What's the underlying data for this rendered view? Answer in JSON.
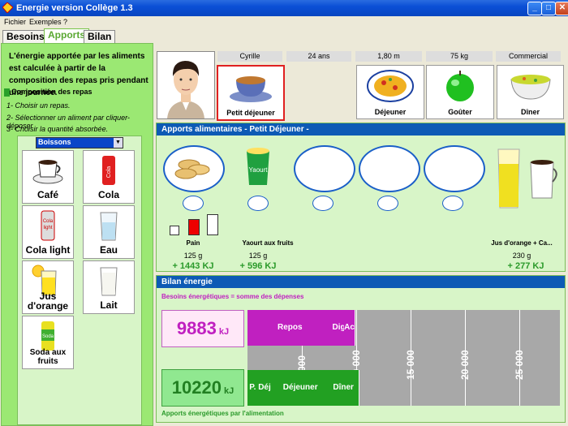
{
  "window": {
    "title": "Energie version Collège 1.3"
  },
  "menu": [
    "Fichier",
    "Exemples",
    "?"
  ],
  "tabs": [
    "Besoins",
    "Apports",
    "Bilan"
  ],
  "left": {
    "intro": "L'énergie apportée par les aliments est calculée à partir de la composition des repas pris pendant une journée.",
    "composition_title": "Composition des repas",
    "steps": [
      "1- Choisir un repas.",
      "2- Sélectionner un aliment par cliquer-déposer",
      "3- Choisir la quantité absorbée."
    ],
    "food_category": "Boissons",
    "foods": [
      "Café",
      "Cola",
      "Cola light",
      "Eau",
      "Jus d'orange",
      "Lait",
      "Soda aux fruits"
    ],
    "food_image_text": {
      "cola": "Cola",
      "cola_light": "Cola light",
      "soda": "Soda"
    }
  },
  "person": {
    "name": "Cyrille",
    "age": "24 ans",
    "height": "1,80 m",
    "weight": "75 kg",
    "job": "Commercial"
  },
  "meals": [
    "Petit déjeuner",
    "Déjeuner",
    "Goûter",
    "Dîner"
  ],
  "apports": {
    "title": "Apports alimentaires - Petit Déjeuner -",
    "items": [
      {
        "name": "Pain",
        "qty": "125 g",
        "kj": "+ 1443 KJ"
      },
      {
        "name": "Yaourt aux fruits",
        "qty": "125 g",
        "kj": "+ 596 KJ"
      },
      {
        "name": "Jus d'orange + Ca...",
        "qty": "230 g",
        "kj": "+ 277 KJ"
      }
    ],
    "yaourt_label": "Yaourt"
  },
  "bilan": {
    "title": "Bilan énergie",
    "besoins_title": "Besoins énergétiques = somme des dépenses",
    "besoins_value": "9883",
    "apports_value": "10220",
    "unit": "kJ",
    "apports_title": "Apports énergétiques par l'alimentation",
    "axis_ticks": [
      "5 000",
      "10 000",
      "15 000",
      "20 000",
      "25 000"
    ],
    "besoins_bars": [
      {
        "label": "Repos",
        "value": 7800
      },
      {
        "label": "Dig",
        "value": 1050
      },
      {
        "label": "Ac",
        "value": 1033
      }
    ],
    "apports_bars": [
      {
        "label": "P. Déj",
        "value": 2316
      },
      {
        "label": "Déjeuner",
        "value": 5100
      },
      {
        "label": "Dîner",
        "value": 2804
      }
    ],
    "colors": {
      "besoins": "#c020c0",
      "apports": "#22a022"
    }
  }
}
